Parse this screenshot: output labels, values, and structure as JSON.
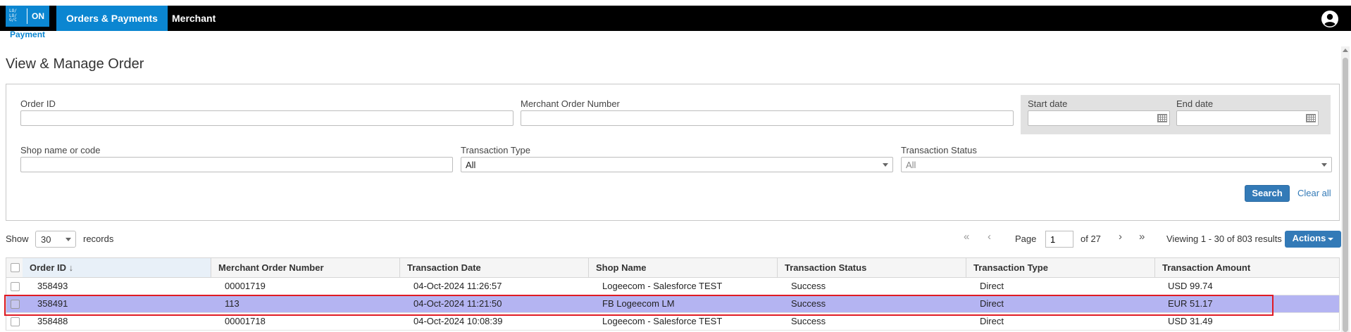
{
  "nav": {
    "logo_text": "ON",
    "logo_mark": "LO/ LO/ G/C",
    "logo_subtitle": "Payment",
    "items": [
      {
        "label": "Orders & Payments",
        "active": true
      },
      {
        "label": "Merchant",
        "active": false
      }
    ],
    "user_icon": "user-circle-icon"
  },
  "page_title": "View & Manage Order",
  "filters": {
    "order_id": {
      "label": "Order ID",
      "value": ""
    },
    "merchant_order_number": {
      "label": "Merchant Order Number",
      "value": ""
    },
    "start_date": {
      "label": "Start date",
      "value": ""
    },
    "end_date": {
      "label": "End date",
      "value": ""
    },
    "shop_name": {
      "label": "Shop name or code",
      "value": ""
    },
    "transaction_type": {
      "label": "Transaction Type",
      "value": "All"
    },
    "transaction_status": {
      "label": "Transaction Status",
      "value": "All"
    },
    "search_label": "Search",
    "clear_label": "Clear all"
  },
  "toolbar": {
    "show_label": "Show",
    "page_size": "30",
    "records_label": "records",
    "page_label": "Page",
    "page_value": "1",
    "of_label": "of 27",
    "viewing": "Viewing 1 - 30 of 803 results",
    "actions_label": "Actions"
  },
  "table": {
    "columns": [
      "Order ID",
      "Merchant Order Number",
      "Transaction Date",
      "Shop Name",
      "Transaction Status",
      "Transaction Type",
      "Transaction Amount"
    ],
    "sort_indicator": "↓",
    "rows": [
      [
        "358493",
        "00001719",
        "04-Oct-2024 11:26:57",
        "Logeecom - Salesforce TEST",
        "Success",
        "Direct",
        "USD 99.74"
      ],
      [
        "358491",
        "113",
        "04-Oct-2024 11:21:50",
        "FB Logeecom LM",
        "Success",
        "Direct",
        "EUR 51.17"
      ],
      [
        "358488",
        "00001718",
        "04-Oct-2024 10:08:39",
        "Logeecom - Salesforce TEST",
        "Success",
        "Direct",
        "USD 31.49"
      ]
    ],
    "highlighted_row": 1
  },
  "colors": {
    "accent": "#0b86d1",
    "button": "#337ab7",
    "highlight": "#b4b4f2",
    "highlight_border": "#e01b24"
  }
}
